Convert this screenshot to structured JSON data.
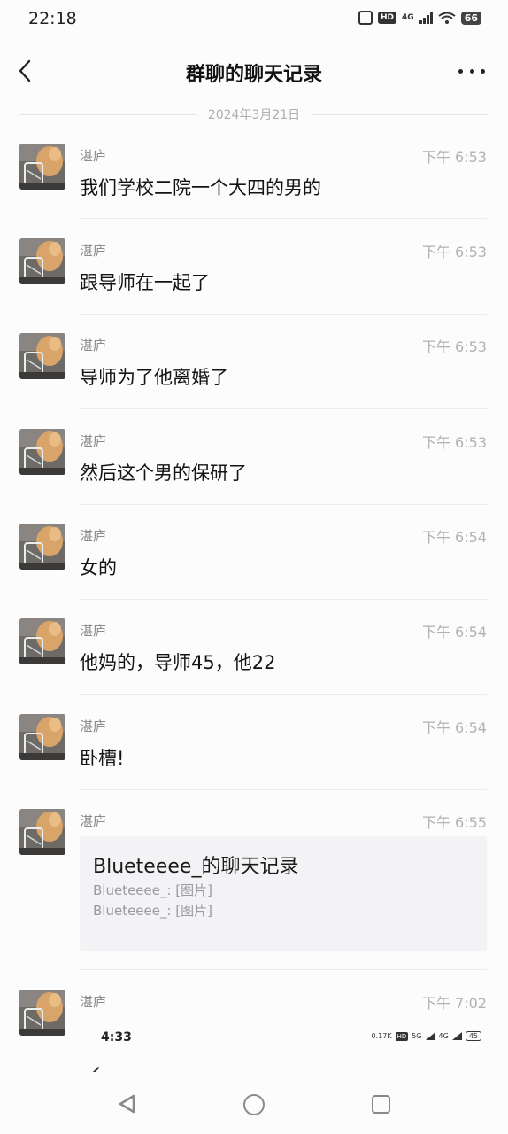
{
  "status_bar": {
    "time": "22:18",
    "hd_label": "HD",
    "network": "4G",
    "battery": "66",
    "icons": [
      "vibrate-icon",
      "hd-icon",
      "signal-icon",
      "wifi-icon",
      "battery-icon"
    ]
  },
  "nav": {
    "title": "群聊的聊天记录",
    "back_icon": "chevron-left-icon",
    "more_icon": "more-dots-icon"
  },
  "date_separator": "2024年3月21日",
  "messages": [
    {
      "sender": "湛庐",
      "time": "下午 6:53",
      "text": "我们学校二院一个大四的男的"
    },
    {
      "sender": "湛庐",
      "time": "下午 6:53",
      "text": "跟导师在一起了"
    },
    {
      "sender": "湛庐",
      "time": "下午 6:53",
      "text": "导师为了他离婚了"
    },
    {
      "sender": "湛庐",
      "time": "下午 6:53",
      "text": "然后这个男的保研了"
    },
    {
      "sender": "湛庐",
      "time": "下午 6:54",
      "text": "女的"
    },
    {
      "sender": "湛庐",
      "time": "下午 6:54",
      "text": "他妈的，导师45，他22"
    },
    {
      "sender": "湛庐",
      "time": "下午 6:54",
      "text": "卧槽!"
    },
    {
      "sender": "湛庐",
      "time": "下午 6:55",
      "record": {
        "title": "Blueteeee_的聊天记录",
        "lines": [
          "Blueteeee_: [图片]",
          "Blueteeee_: [图片]"
        ]
      }
    },
    {
      "sender": "湛庐",
      "time": "下午 7:02"
    }
  ],
  "embedded_screenshot": {
    "time": "4:33",
    "speed": "0.17",
    "speed_unit": "K",
    "hd_label": "HD",
    "network_a": "5G",
    "network_b": "4G",
    "battery": "45"
  },
  "system_nav": {
    "icons": [
      "back-triangle-icon",
      "home-circle-icon",
      "recents-square-icon"
    ]
  },
  "colors": {
    "background": "#fdfcfd",
    "secondary_text": "#8c8a8c",
    "time_text": "#b3b1b3",
    "card_bg": "#f3f2f4"
  }
}
